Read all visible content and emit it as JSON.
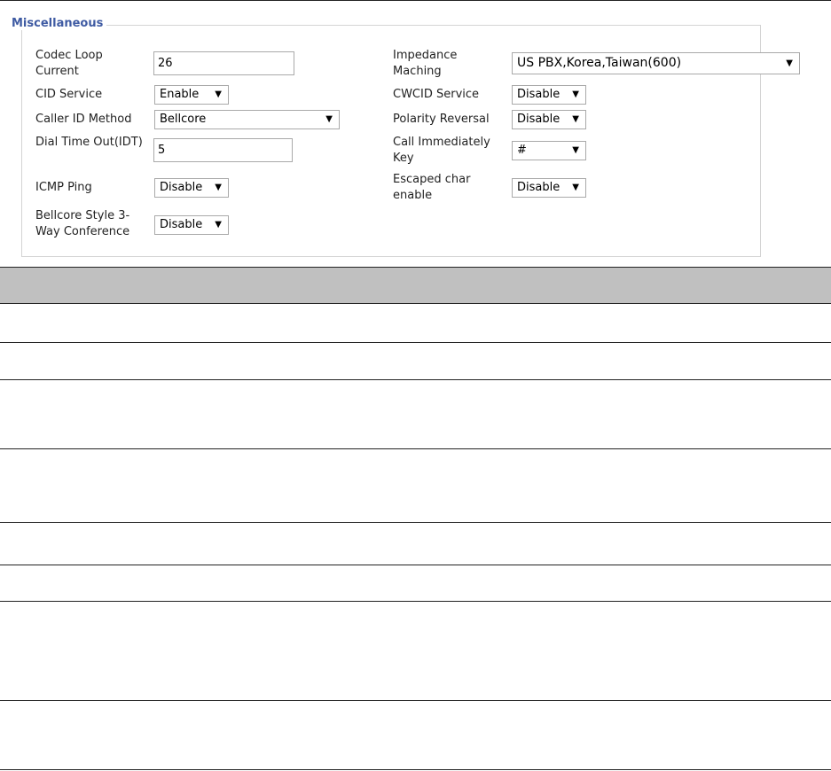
{
  "section": {
    "title": "Miscellaneous"
  },
  "fields": {
    "codec_loop_current": {
      "label": "Codec Loop Current",
      "value": "26"
    },
    "cid_service": {
      "label": "CID Service",
      "value": "Enable"
    },
    "caller_id_method": {
      "label": "Caller ID Method",
      "value": "Bellcore"
    },
    "dial_time_out": {
      "label": "Dial Time Out(IDT)",
      "value": "5"
    },
    "icmp_ping": {
      "label": "ICMP Ping",
      "value": "Disable"
    },
    "bellcore_3way": {
      "label": "Bellcore Style 3-Way Conference",
      "value": "Disable"
    },
    "impedance_matching": {
      "label": "Impedance Maching",
      "value": "US PBX,Korea,Taiwan(600)"
    },
    "cwcid_service": {
      "label": "CWCID Service",
      "value": "Disable"
    },
    "polarity_reversal": {
      "label": "Polarity Reversal",
      "value": "Disable"
    },
    "call_immediately_key": {
      "label": "Call Immediately Key",
      "value": "#"
    },
    "escaped_char_enable": {
      "label": "Escaped char enable",
      "value": "Disable"
    }
  },
  "icons": {
    "dropdown": "triangle-down-icon"
  },
  "colors": {
    "legend": "#3f5ba3",
    "table_header": "#c0c0c0"
  }
}
